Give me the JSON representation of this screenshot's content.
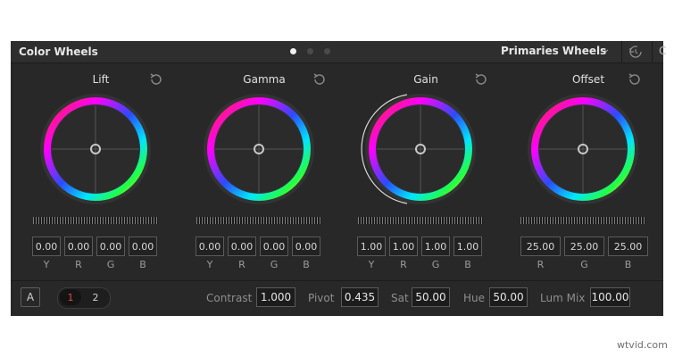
{
  "header": {
    "title": "Color Wheels",
    "mode": "Primaries Wheels",
    "page_dots": 3,
    "active_dot": 0
  },
  "wheels": [
    {
      "name": "Lift",
      "values": [
        "0.00",
        "0.00",
        "0.00",
        "0.00"
      ],
      "labels": [
        "Y",
        "R",
        "G",
        "B"
      ]
    },
    {
      "name": "Gamma",
      "values": [
        "0.00",
        "0.00",
        "0.00",
        "0.00"
      ],
      "labels": [
        "Y",
        "R",
        "G",
        "B"
      ]
    },
    {
      "name": "Gain",
      "values": [
        "1.00",
        "1.00",
        "1.00",
        "1.00"
      ],
      "labels": [
        "Y",
        "R",
        "G",
        "B"
      ]
    },
    {
      "name": "Offset",
      "values": [
        "25.00",
        "25.00",
        "25.00"
      ],
      "labels": [
        "R",
        "G",
        "B"
      ]
    }
  ],
  "footer": {
    "a_button": "A",
    "page1": "1",
    "page2": "2",
    "contrast_label": "Contrast",
    "contrast_value": "1.000",
    "pivot_label": "Pivot",
    "pivot_value": "0.435",
    "sat_label": "Sat",
    "sat_value": "50.00",
    "hue_label": "Hue",
    "hue_value": "50.00",
    "lummix_label": "Lum Mix",
    "lummix_value": "100.00"
  },
  "watermark": "wtvid.com",
  "colors": {
    "accent_page": "#e14646",
    "panel_bg": "#282828"
  },
  "icons": {
    "reset": "reset-icon",
    "chevron": "chevron-down-icon"
  }
}
